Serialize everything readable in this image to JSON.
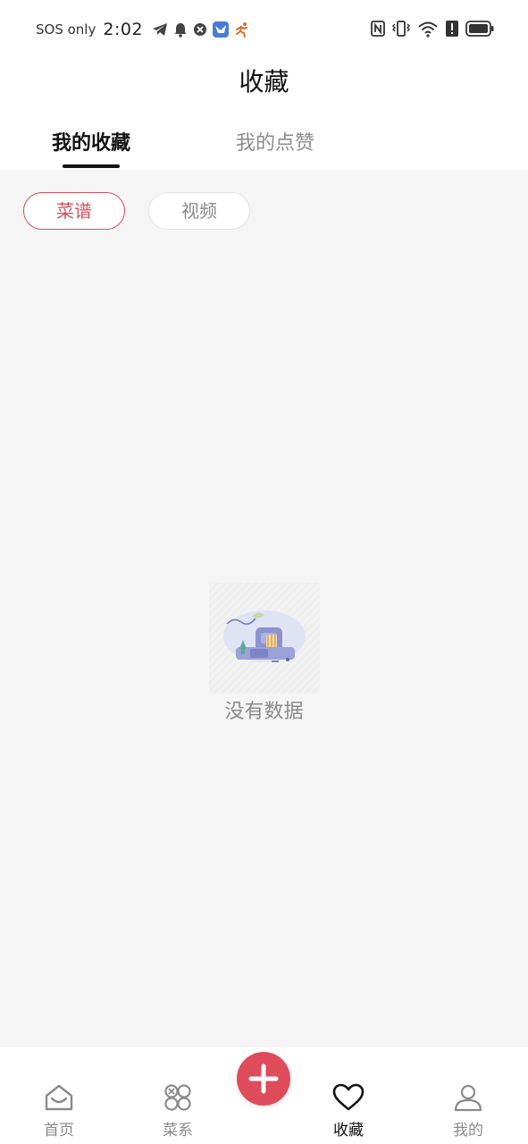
{
  "status_bar": {
    "carrier": "SOS only",
    "time": "2:02",
    "icons_left": [
      "telegram-icon",
      "bell-icon",
      "vpn-shield-icon",
      "app-bird-icon",
      "app-runner-icon"
    ],
    "icons_right": [
      "nfc-icon",
      "vibrate-icon",
      "wifi-6-icon",
      "alert-icon",
      "battery-icon"
    ]
  },
  "header": {
    "title": "收藏"
  },
  "tabs": [
    {
      "label": "我的收藏",
      "active": true
    },
    {
      "label": "我的点赞",
      "active": false
    }
  ],
  "filters": [
    {
      "label": "菜谱",
      "active": true
    },
    {
      "label": "视频",
      "active": false
    }
  ],
  "empty_state": {
    "text": "没有数据",
    "illustration": "empty-box-icon"
  },
  "bottom_nav": {
    "items": [
      {
        "label": "首页",
        "icon": "home-icon",
        "active": false
      },
      {
        "label": "菜系",
        "icon": "categories-icon",
        "active": false
      },
      {
        "label": "收藏",
        "icon": "heart-icon",
        "active": true
      },
      {
        "label": "我的",
        "icon": "profile-icon",
        "active": false
      }
    ],
    "fab_icon": "plus-icon"
  },
  "colors": {
    "accent": "#de4b5a",
    "active_chip": "#d0515f",
    "background": "#f5f5f5",
    "text_primary": "#111111",
    "text_secondary": "#8a8a8a"
  }
}
